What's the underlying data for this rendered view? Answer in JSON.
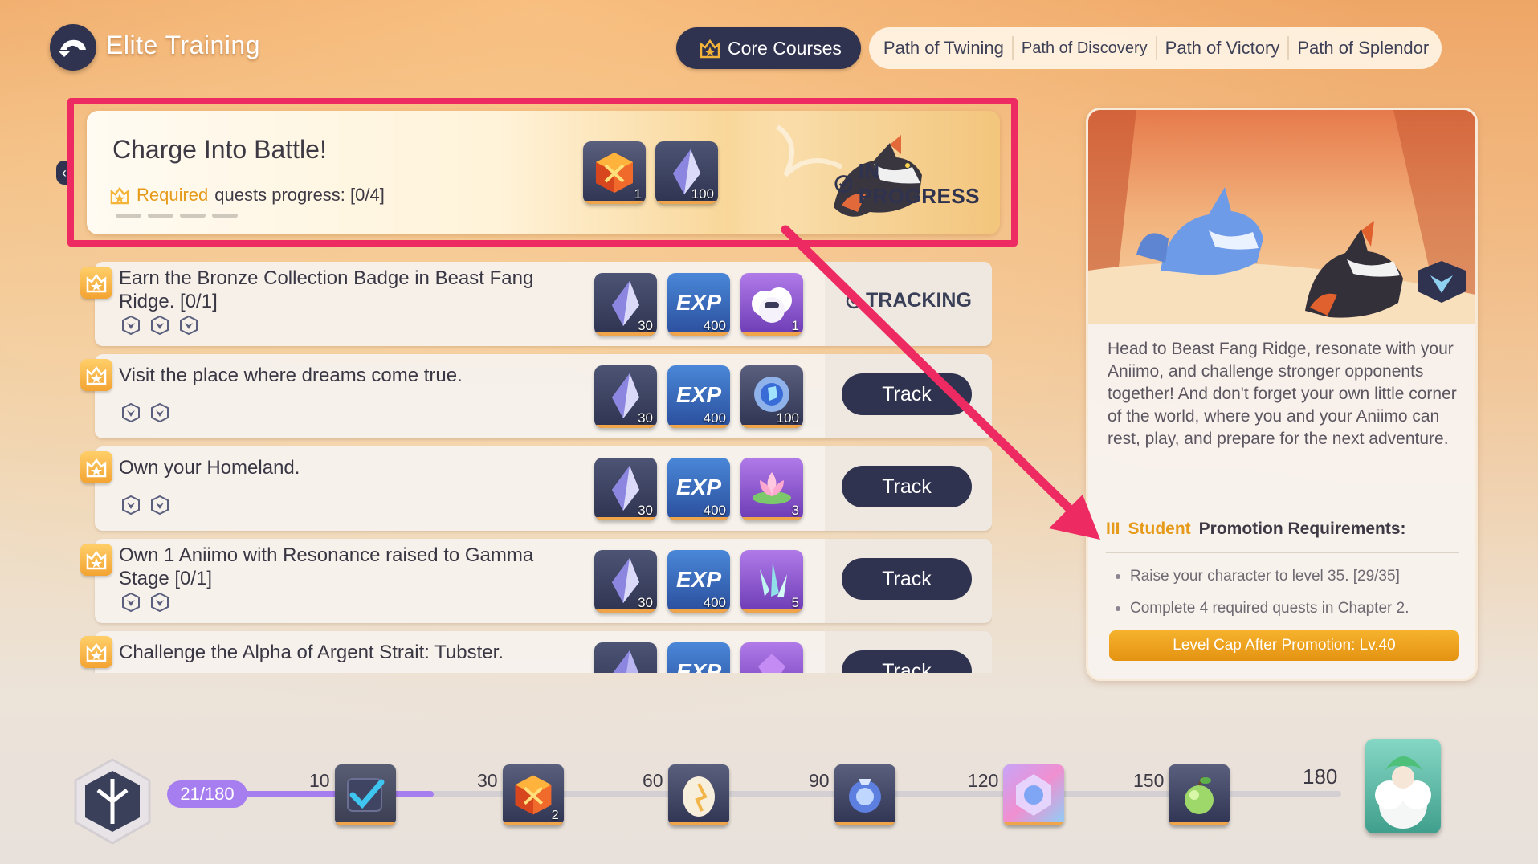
{
  "header": {
    "title": "Elite Training",
    "tabs": {
      "active": "Core Courses",
      "others": [
        "Path of Twining",
        "Path of Discovery",
        "Path of Victory",
        "Path of Splendor"
      ]
    }
  },
  "featured": {
    "title": "Charge Into Battle!",
    "required_word": "Required",
    "progress_text": "quests progress: [0/4]",
    "status": "IN PROGRESS",
    "rewards": [
      {
        "icon": "red-cube-icon",
        "qty": "1"
      },
      {
        "icon": "crystal-icon",
        "qty": "100"
      }
    ]
  },
  "quests": [
    {
      "text": "Earn the Bronze Collection Badge in Beast Fang Ridge. [0/1]",
      "marks": 3,
      "status": "TRACKING",
      "rewards": [
        {
          "icon": "crystal-icon",
          "qty": "30"
        },
        {
          "icon": "exp-icon",
          "qty": "400"
        },
        {
          "icon": "cloud-creature-icon",
          "qty": "1"
        }
      ]
    },
    {
      "text": "Visit the place where dreams come true.",
      "marks": 2,
      "action": "Track",
      "rewards": [
        {
          "icon": "crystal-icon",
          "qty": "30"
        },
        {
          "icon": "exp-icon",
          "qty": "400"
        },
        {
          "icon": "blue-orb-icon",
          "qty": "100"
        }
      ]
    },
    {
      "text": "Own your Homeland.",
      "marks": 2,
      "action": "Track",
      "rewards": [
        {
          "icon": "crystal-icon",
          "qty": "30"
        },
        {
          "icon": "exp-icon",
          "qty": "400"
        },
        {
          "icon": "lotus-icon",
          "qty": "3"
        }
      ]
    },
    {
      "text": "Own 1 Aniimo with Resonance raised to Gamma Stage [0/1]",
      "marks": 2,
      "action": "Track",
      "rewards": [
        {
          "icon": "crystal-icon",
          "qty": "30"
        },
        {
          "icon": "exp-icon",
          "qty": "400"
        },
        {
          "icon": "ice-crystal-icon",
          "qty": "5"
        }
      ]
    },
    {
      "text": "Challenge the Alpha of Argent Strait: Tubster.",
      "marks": 0,
      "action": "Track",
      "rewards": [
        {
          "icon": "crystal-icon",
          "qty": ""
        },
        {
          "icon": "exp-icon",
          "qty": ""
        },
        {
          "icon": "purple-gem-icon",
          "qty": ""
        }
      ]
    }
  ],
  "panel": {
    "description": "Head to Beast Fang Ridge, resonate with your Aniimo, and challenge stronger opponents together! And don't forget your own little corner of the world, where you and your Aniimo can rest, play, and prepare for the next adventure.",
    "rank": "III",
    "rank_name": "Student",
    "promo_title": "Promotion Requirements:",
    "requirements": [
      "Raise your character to level 35. [29/35]",
      "Complete 4 required quests in Chapter 2."
    ],
    "level_cap": "Level Cap After Promotion: Lv.40"
  },
  "progress": {
    "current": 21,
    "max": 180,
    "label": "21/180",
    "milestones": [
      {
        "value": "10",
        "icon": "checked-box-icon",
        "qty": "",
        "claimed": true
      },
      {
        "value": "30",
        "icon": "red-cube-icon",
        "qty": "2"
      },
      {
        "value": "60",
        "icon": "egg-icon",
        "qty": ""
      },
      {
        "value": "90",
        "icon": "blue-orb-icon",
        "qty": ""
      },
      {
        "value": "120",
        "icon": "rainbow-gem-icon",
        "qty": ""
      },
      {
        "value": "150",
        "icon": "green-fruit-icon",
        "qty": ""
      }
    ],
    "final_label": "180",
    "final_icon": "final-creature-icon"
  },
  "colors": {
    "accent_dark": "#2f3350",
    "highlight": "#ee2a62",
    "progress": "#a77ef0",
    "gold": "#e69a1a"
  }
}
